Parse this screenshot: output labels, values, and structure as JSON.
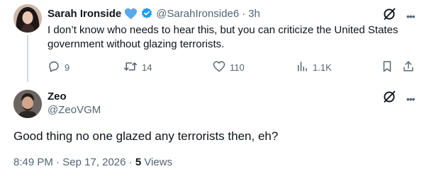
{
  "parent_tweet": {
    "display_name": "Sarah Ironside",
    "handle": "@SarahIronside6",
    "separator": "·",
    "time": "3h",
    "text": "I don’t know who needs to hear this, but you can criticize the United States government without glazing terrorists.",
    "actions": {
      "replies": "9",
      "retweets": "14",
      "likes": "110",
      "views": "1.1K"
    }
  },
  "reply_tweet": {
    "display_name": "Zeo",
    "handle": "@ZeoVGM",
    "text": "Good thing no one glazed any terrorists then, eh?",
    "time": "8:49 PM",
    "separator": "·",
    "date": "Sep 17, 2026",
    "separator2": "·",
    "views_count": "5",
    "views_label": "Views"
  },
  "colors": {
    "text_primary": "#0f1419",
    "text_secondary": "#536471",
    "verified_blue": "#1d9bf0",
    "heart_badge_blue": "#5aa9e6",
    "thread_line": "#cfd9de"
  },
  "icons": {
    "heart_badge": "blue-heart-icon",
    "verified": "verified-badge-icon",
    "grok": "grok-icon",
    "more": "more-dots-icon",
    "reply": "reply-icon",
    "retweet": "retweet-icon",
    "like": "like-icon",
    "views": "views-icon",
    "bookmark": "bookmark-icon",
    "share": "share-icon"
  }
}
